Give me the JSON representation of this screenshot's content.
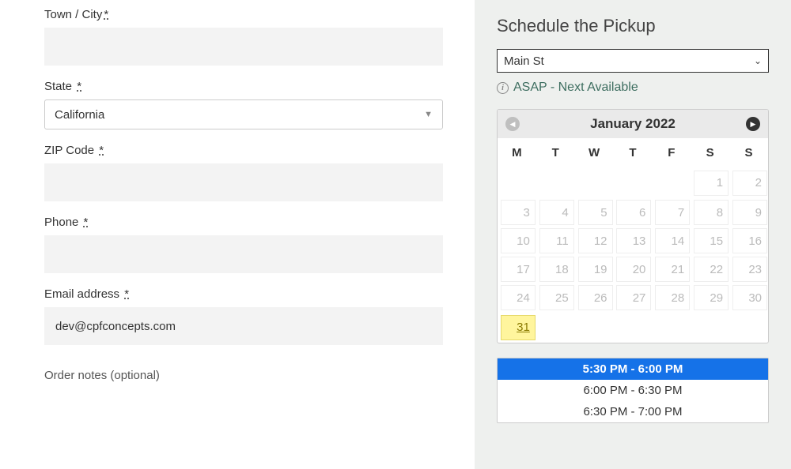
{
  "form": {
    "town_city": {
      "label": "Town / City",
      "req": "*",
      "value": ""
    },
    "state": {
      "label": "State",
      "req": "*",
      "selected": "California"
    },
    "zip": {
      "label": "ZIP Code",
      "req": "*",
      "value": ""
    },
    "phone": {
      "label": "Phone",
      "req": "*",
      "value": ""
    },
    "email": {
      "label": "Email address",
      "req": "*",
      "value": "dev@cpfconcepts.com"
    },
    "order_notes": {
      "label": "Order notes (optional)"
    }
  },
  "schedule": {
    "title": "Schedule the Pickup",
    "location_selected": "Main St",
    "asap_label": "ASAP - Next Available",
    "calendar": {
      "month_label": "January 2022",
      "dow": [
        "M",
        "T",
        "W",
        "T",
        "F",
        "S",
        "S"
      ],
      "weeks": [
        [
          null,
          null,
          null,
          null,
          null,
          1,
          2
        ],
        [
          3,
          4,
          5,
          6,
          7,
          8,
          9
        ],
        [
          10,
          11,
          12,
          13,
          14,
          15,
          16
        ],
        [
          17,
          18,
          19,
          20,
          21,
          22,
          23
        ],
        [
          24,
          25,
          26,
          27,
          28,
          29,
          30
        ],
        [
          31,
          null,
          null,
          null,
          null,
          null,
          null
        ]
      ],
      "selected_day": 31
    },
    "time_slots": [
      {
        "label": "5:30 PM - 6:00 PM",
        "selected": true
      },
      {
        "label": "6:00 PM - 6:30 PM",
        "selected": false
      },
      {
        "label": "6:30 PM - 7:00 PM",
        "selected": false
      }
    ]
  }
}
